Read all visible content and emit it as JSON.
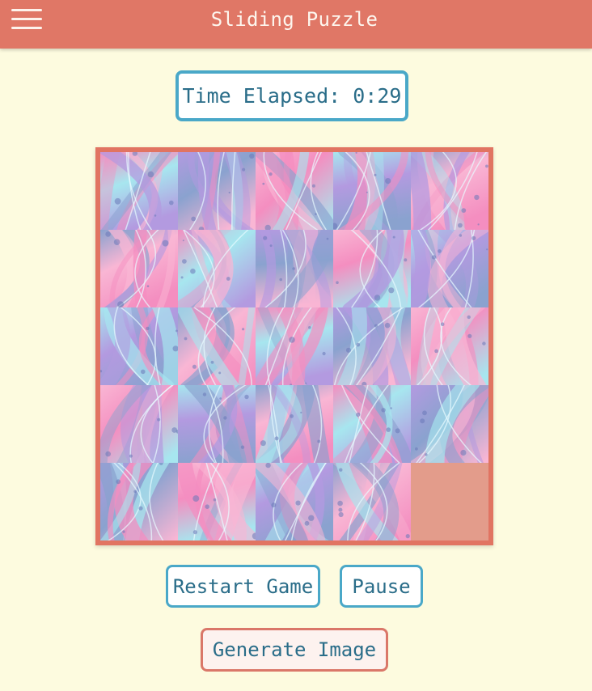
{
  "header": {
    "title": "Sliding Puzzle",
    "menu_icon": "hamburger-menu-icon",
    "background_color": "#e07766"
  },
  "timer": {
    "label": "Time Elapsed: 0:29"
  },
  "puzzle": {
    "grid_size": 5,
    "empty_tile": {
      "row": 5,
      "col": 5
    },
    "tile_count": 24,
    "image_palette": [
      "#f48ec0",
      "#a7e6ef",
      "#b39ae0",
      "#8aa2cf",
      "#f9b6d4"
    ]
  },
  "controls": {
    "restart_label": "Restart Game",
    "pause_label": "Pause",
    "generate_label": "Generate Image"
  },
  "colors": {
    "page_background": "#fdfbdf",
    "accent_blue": "#4aa8c8",
    "accent_coral": "#e17462",
    "text_blue": "#2a6d89"
  }
}
